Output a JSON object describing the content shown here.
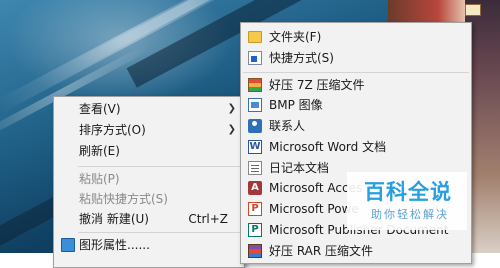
{
  "main_menu": {
    "items": [
      {
        "label": "查看(V)",
        "has_submenu": true,
        "enabled": true
      },
      {
        "label": "排序方式(O)",
        "has_submenu": true,
        "enabled": true
      },
      {
        "label": "刷新(E)",
        "enabled": true
      },
      {
        "label": "粘贴(P)",
        "enabled": false
      },
      {
        "label": "粘贴快捷方式(S)",
        "enabled": false
      },
      {
        "label": "撤消 新建(U)",
        "shortcut": "Ctrl+Z",
        "enabled": true
      },
      {
        "label": "图形属性......",
        "enabled": true
      }
    ]
  },
  "new_submenu": {
    "items": [
      {
        "label": "文件夹(F)",
        "icon": "folder-icon"
      },
      {
        "label": "快捷方式(S)",
        "icon": "shortcut-icon"
      },
      {
        "label": "好压 7Z 压缩文件",
        "icon": "archive-7z-icon"
      },
      {
        "label": "BMP 图像",
        "icon": "bmp-image-icon"
      },
      {
        "label": "联系人",
        "icon": "contact-icon"
      },
      {
        "label": "Microsoft Word 文档",
        "icon": "word-icon"
      },
      {
        "label": "日记本文档",
        "icon": "journal-icon"
      },
      {
        "label": "Microsoft Acces",
        "icon": "access-icon"
      },
      {
        "label": "Microsoft Powe",
        "icon": "powerpoint-icon"
      },
      {
        "label": "Microsoft Publisher Document",
        "icon": "publisher-icon"
      },
      {
        "label": "好压 RAR 压缩文件",
        "icon": "archive-rar-icon"
      }
    ]
  },
  "icon_glyphs": {
    "word": "W",
    "access": "A",
    "powerpoint": "P",
    "publisher": "P"
  },
  "watermark": {
    "title": "百科全说",
    "subtitle": "助你轻松解决"
  },
  "colors": {
    "menu_bg": "#f2f2f2",
    "disabled_text": "#8a8a8a",
    "watermark_blue": "#27a0e0"
  }
}
